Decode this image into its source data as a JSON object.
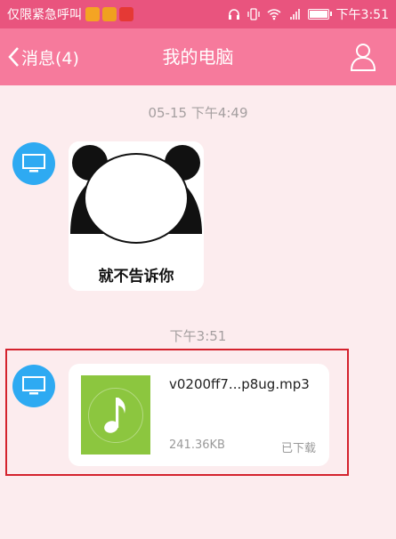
{
  "status_bar": {
    "carrier": "仅限紧急呼叫",
    "time": "下午3:51",
    "notification_colors": [
      "#f4a423",
      "#f0a020",
      "#e53935"
    ]
  },
  "nav": {
    "back_label": "消息(4)",
    "title": "我的电脑"
  },
  "messages": {
    "ts1": "05-15 下午4:49",
    "sticker_caption": "就不告诉你",
    "ts2": "下午3:51",
    "file": {
      "name": "v0200ff7...p8ug.mp3",
      "size": "241.36KB",
      "status": "已下载"
    }
  },
  "colors": {
    "status_bar": "#e9547e",
    "nav_bar": "#f67a9c",
    "avatar": "#2eaaf2",
    "file_thumb": "#8cc63f",
    "highlight": "#d4222d"
  }
}
